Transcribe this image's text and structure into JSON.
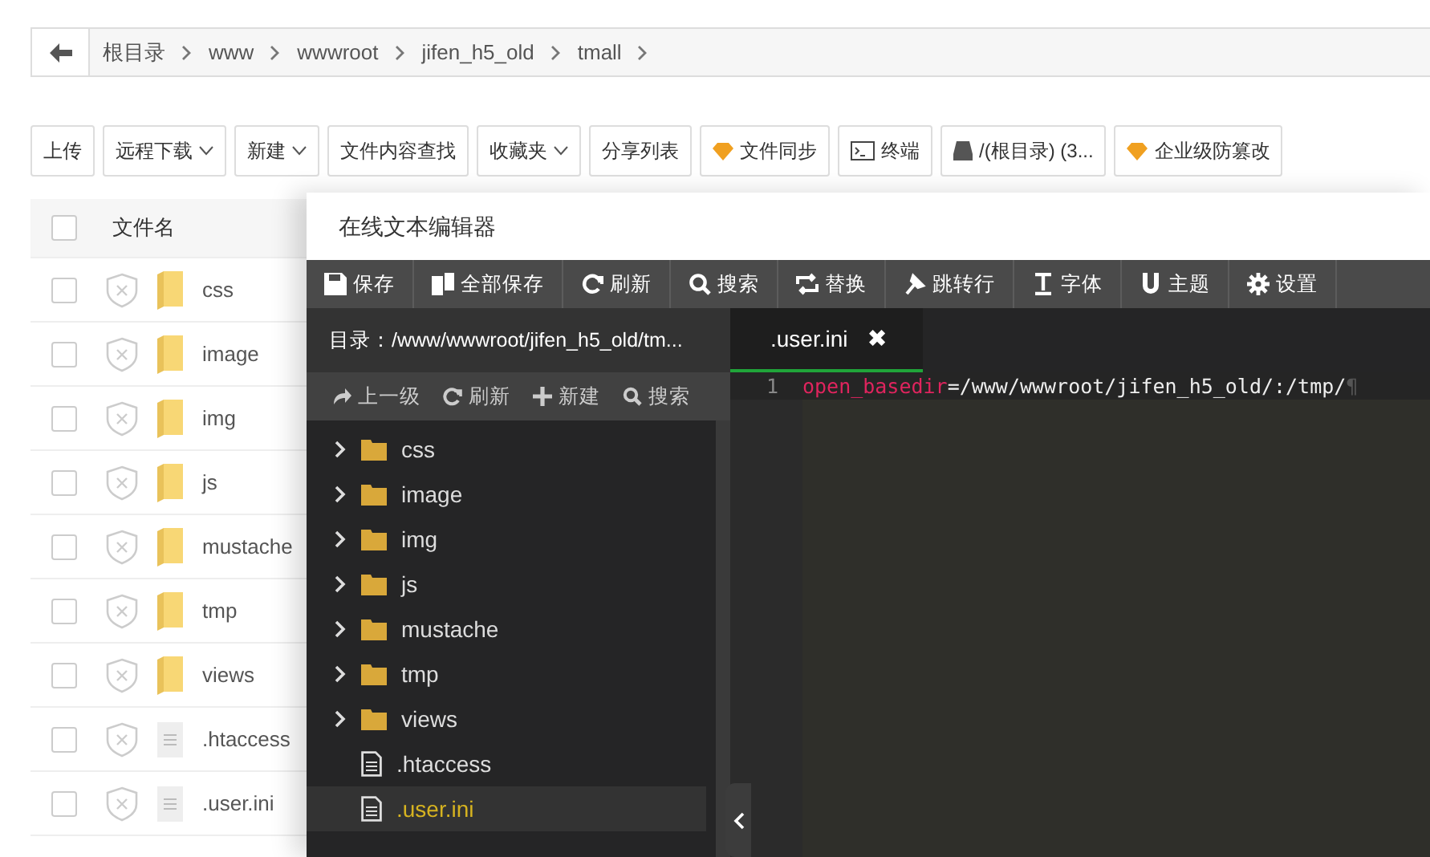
{
  "breadcrumb": {
    "items": [
      "根目录",
      "www",
      "wwwroot",
      "jifen_h5_old",
      "tmall"
    ]
  },
  "toolbar": [
    {
      "label": "上传",
      "kind": "plain"
    },
    {
      "label": "远程下载",
      "kind": "dropdown"
    },
    {
      "label": "新建",
      "kind": "dropdown"
    },
    {
      "label": "文件内容查找",
      "kind": "plain"
    },
    {
      "label": "收藏夹",
      "kind": "dropdown"
    },
    {
      "label": "分享列表",
      "kind": "plain"
    },
    {
      "label": "文件同步",
      "kind": "gem"
    },
    {
      "label": "终端",
      "kind": "terminal"
    },
    {
      "label": "/(根目录) (3...",
      "kind": "disk"
    },
    {
      "label": "企业级防篡改",
      "kind": "gem"
    }
  ],
  "file_list": {
    "header": "文件名",
    "header_checked": false,
    "rows": [
      {
        "name": "css",
        "kind": "folder",
        "checked": false
      },
      {
        "name": "image",
        "kind": "folder",
        "checked": false
      },
      {
        "name": "img",
        "kind": "folder",
        "checked": false
      },
      {
        "name": "js",
        "kind": "folder",
        "checked": false
      },
      {
        "name": "mustache",
        "kind": "folder",
        "checked": false
      },
      {
        "name": "tmp",
        "kind": "folder",
        "checked": false
      },
      {
        "name": "views",
        "kind": "folder",
        "checked": false
      },
      {
        "name": ".htaccess",
        "kind": "file",
        "checked": false
      },
      {
        "name": ".user.ini",
        "kind": "file",
        "checked": false
      }
    ]
  },
  "editor": {
    "title": "在线文本编辑器",
    "toolbar": [
      "保存",
      "全部保存",
      "刷新",
      "搜索",
      "替换",
      "跳转行",
      "字体",
      "主题",
      "设置"
    ],
    "directory": "目录：/www/wwwroot/jifen_h5_old/tm...",
    "tree_actions": [
      "上一级",
      "刷新",
      "新建",
      "搜索"
    ],
    "tree": [
      {
        "name": "css",
        "kind": "folder",
        "selected": false
      },
      {
        "name": "image",
        "kind": "folder",
        "selected": false
      },
      {
        "name": "img",
        "kind": "folder",
        "selected": false
      },
      {
        "name": "js",
        "kind": "folder",
        "selected": false
      },
      {
        "name": "mustache",
        "kind": "folder",
        "selected": false
      },
      {
        "name": "tmp",
        "kind": "folder",
        "selected": false
      },
      {
        "name": "views",
        "kind": "folder",
        "selected": false
      },
      {
        "name": ".htaccess",
        "kind": "file",
        "selected": false
      },
      {
        "name": ".user.ini",
        "kind": "file",
        "selected": true
      }
    ],
    "tab": {
      "label": ".user.ini",
      "close": "✖"
    },
    "lines": [
      {
        "number": "1",
        "key": "open_basedir",
        "value": "=/www/wwwroot/jifen_h5_old/:/tmp/",
        "end_mark": "¶"
      }
    ]
  }
}
